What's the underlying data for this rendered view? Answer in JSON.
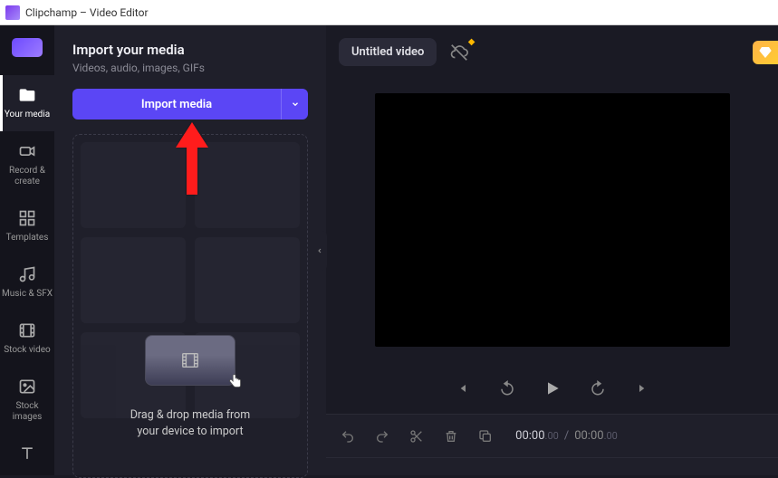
{
  "window": {
    "title": "Clipchamp – Video Editor"
  },
  "nav": {
    "items": [
      {
        "label": "Your media"
      },
      {
        "label": "Record & create"
      },
      {
        "label": "Templates"
      },
      {
        "label": "Music & SFX"
      },
      {
        "label": "Stock video"
      },
      {
        "label": "Stock images"
      }
    ]
  },
  "panel": {
    "title": "Import your media",
    "subtitle": "Videos, audio, images, GIFs",
    "import_label": "Import media",
    "dropzone_line1": "Drag & drop media from",
    "dropzone_line2": "your device to import"
  },
  "workspace": {
    "title": "Untitled video"
  },
  "timeline": {
    "current": "00:00",
    "current_sub": ".00",
    "total": "00:00",
    "total_sub": ".00"
  }
}
